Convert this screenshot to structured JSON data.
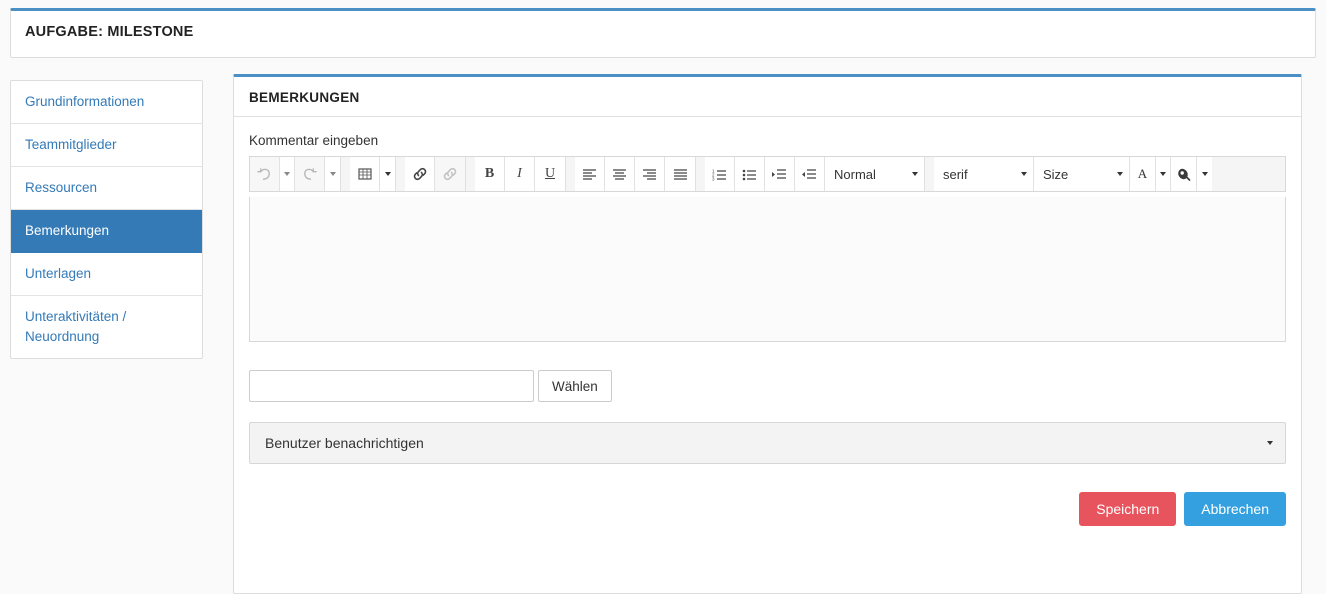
{
  "header": {
    "title": "AUFGABE: MILESTONE",
    "accent_color": "#4a90c4"
  },
  "sidebar": {
    "items": [
      {
        "label": "Grundinformationen",
        "active": false
      },
      {
        "label": "Teammitglieder",
        "active": false
      },
      {
        "label": "Ressourcen",
        "active": false
      },
      {
        "label": "Bemerkungen",
        "active": true
      },
      {
        "label": "Unterlagen",
        "active": false
      },
      {
        "label": "Unteraktivitäten / Neuordnung",
        "active": false
      }
    ],
    "active_bg": "#337ab7",
    "link_color": "#337ab7"
  },
  "main": {
    "panel_title": "BEMERKUNGEN",
    "comment_label": "Kommentar eingeben",
    "editor": {
      "content": "",
      "toolbar": {
        "undo": "undo-icon",
        "redo": "redo-icon",
        "table": "table-icon",
        "link": "link-icon",
        "unlink": "unlink-icon",
        "bold": "B",
        "italic": "I",
        "underline": "U",
        "align_left": "align-left-icon",
        "align_center": "align-center-icon",
        "align_right": "align-right-icon",
        "align_justify": "align-justify-icon",
        "ordered_list": "ordered-list-icon",
        "unordered_list": "unordered-list-icon",
        "indent": "indent-icon",
        "outdent": "outdent-icon",
        "style_select": "Normal",
        "font_select": "serif",
        "size_select": "Size",
        "font_color": "A",
        "highlight_color": "highlight-icon"
      }
    },
    "file": {
      "value": "",
      "browse_label": "Wählen"
    },
    "notify": {
      "selected": "Benutzer benachrichtigen"
    },
    "buttons": {
      "save": "Speichern",
      "cancel": "Abbrechen",
      "save_color": "#e8545d",
      "cancel_color": "#35a0e0"
    }
  }
}
